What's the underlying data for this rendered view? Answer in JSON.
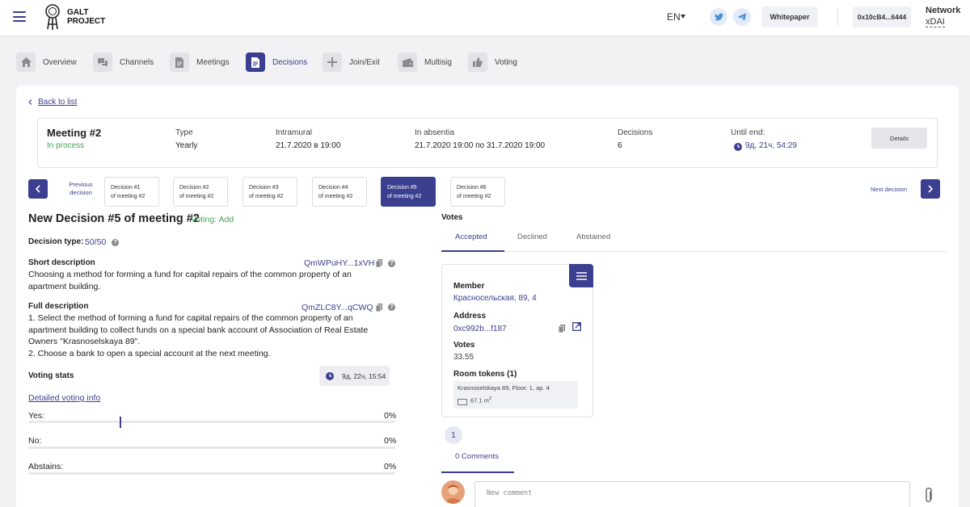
{
  "header": {
    "logo_line1": "GALT",
    "logo_line2": "PROJECT",
    "lang": "EN",
    "whitepaper_label": "Whitepaper",
    "wallet_address": "0x10cB4...6444",
    "network_label": "Network",
    "network_value": "xDAI"
  },
  "nav": {
    "items": [
      {
        "label": "Overview",
        "icon": "home-icon"
      },
      {
        "label": "Channels",
        "icon": "chat-icon"
      },
      {
        "label": "Meetings",
        "icon": "document-icon"
      },
      {
        "label": "Decisions",
        "icon": "decision-icon",
        "active": true
      },
      {
        "label": "Join/Exit",
        "icon": "plus-icon"
      },
      {
        "label": "Multisig",
        "icon": "wallet-icon"
      },
      {
        "label": "Voting",
        "icon": "thumbs-up-icon"
      }
    ]
  },
  "meeting": {
    "back_label": "Back to list",
    "title": "Meeting #2",
    "status": "In process",
    "type_label": "Type",
    "type_value": "Yearly",
    "intramural_label": "Intramural",
    "intramural_value": "21.7.2020 в 19:00",
    "absentia_label": "In absentia",
    "absentia_value": "21.7.2020 19:00 по 31.7.2020 19:00",
    "decisions_label": "Decisions",
    "decisions_value": "6",
    "until_label": "Until end:",
    "until_value": "9д, 21ч, 54:29",
    "details_label": "Details"
  },
  "decision_nav": {
    "previous_line1": "Previous",
    "previous_line2": "decision",
    "next_label": "Next decision",
    "tabs": [
      {
        "line1": "Decision #1",
        "line2": "of meeting #2"
      },
      {
        "line1": "Decision #2",
        "line2": "of meeting #2"
      },
      {
        "line1": "Decision #3",
        "line2": "of meeting #2"
      },
      {
        "line1": "Decision #4",
        "line2": "of meeting #2"
      },
      {
        "line1": "Decision #5",
        "line2": "of meeting #2",
        "active": true
      },
      {
        "line1": "Decision #6",
        "line2": "of meeting #2"
      }
    ]
  },
  "decision": {
    "title": "New Decision #5 of meeting #2",
    "voting_add": "Voting: Add",
    "type_label": "Decision type:",
    "type_value": "50/50",
    "short_label": "Short description",
    "short_hash": "QmWPuHY...1xVH",
    "short_text_line1": "Choosing a method for forming a fund for capital repairs of the common property of an",
    "short_text_line2": "apartment building.",
    "full_label": "Full description",
    "full_hash": "QmZLC8Y...qCWQ",
    "full_text_line1": "1. Select the method of forming a fund for capital repairs of the common property of an",
    "full_text_line2": "apartment building to collect funds on a special bank account of Association of Real Estate",
    "full_text_line3": "Owners \"Krasnoselskaya 89\".",
    "full_text_line4": "2. Choose a bank to open a special account at the next meeting.",
    "stats_label": "Voting stats",
    "stats_timer": "9д, 22ч, 15:54",
    "detailed_link": "Detailed voting info",
    "stats": [
      {
        "label": "Yes:",
        "pct": "0%"
      },
      {
        "label": "No:",
        "pct": "0%"
      },
      {
        "label": "Abstains:",
        "pct": "0%"
      }
    ]
  },
  "votes": {
    "title": "Votes",
    "tabs": [
      "Accepted",
      "Declined",
      "Abstained"
    ],
    "member_label": "Member",
    "member_value": "Красносельская, 89, 4",
    "address_label": "Address",
    "address_value": "0xc992b...f187",
    "votes_label": "Votes",
    "votes_value": "33.55",
    "room_tokens_label": "Room tokens (1)",
    "token_name": "Krasnoselskaya 89, Floor: 1, ap. 4",
    "token_area": "67.1 m",
    "token_area_sup": "2",
    "page": "1",
    "comments_label": "0 Comments",
    "comment_placeholder": "New comment"
  }
}
